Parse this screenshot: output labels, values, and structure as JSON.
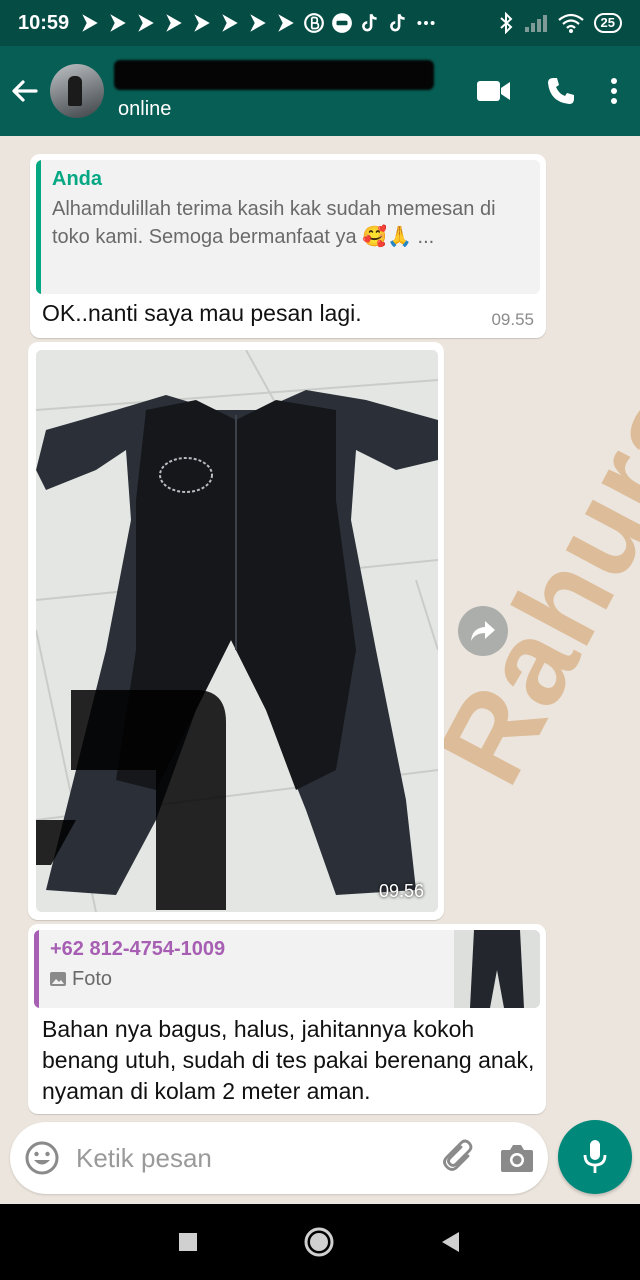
{
  "status_bar": {
    "time": "10:59",
    "battery": "25"
  },
  "header": {
    "status": "online"
  },
  "messages": {
    "m1": {
      "quote_author": "Anda",
      "quote_text": "Alhamdulillah terima kasih kak sudah memesan di toko kami. Semoga bermanfaat ya 🥰🙏 ...",
      "text": "OK..nanti saya mau pesan lagi.",
      "time": "09.55"
    },
    "m2": {
      "time": "09.56"
    },
    "m3": {
      "quote_author": "+62 812-4754-1009",
      "quote_type": "Foto",
      "text": "Bahan nya bagus, halus, jahitannya kokoh benang utuh, sudah di tes pakai berenang anak, nyaman di kolam 2 meter aman."
    }
  },
  "input": {
    "placeholder": "Ketik pesan"
  },
  "colors": {
    "header": "#075e54",
    "status_bar": "#054c44",
    "accent": "#00897b",
    "quote_self": "#06a884",
    "quote_other": "#a75fb3"
  }
}
